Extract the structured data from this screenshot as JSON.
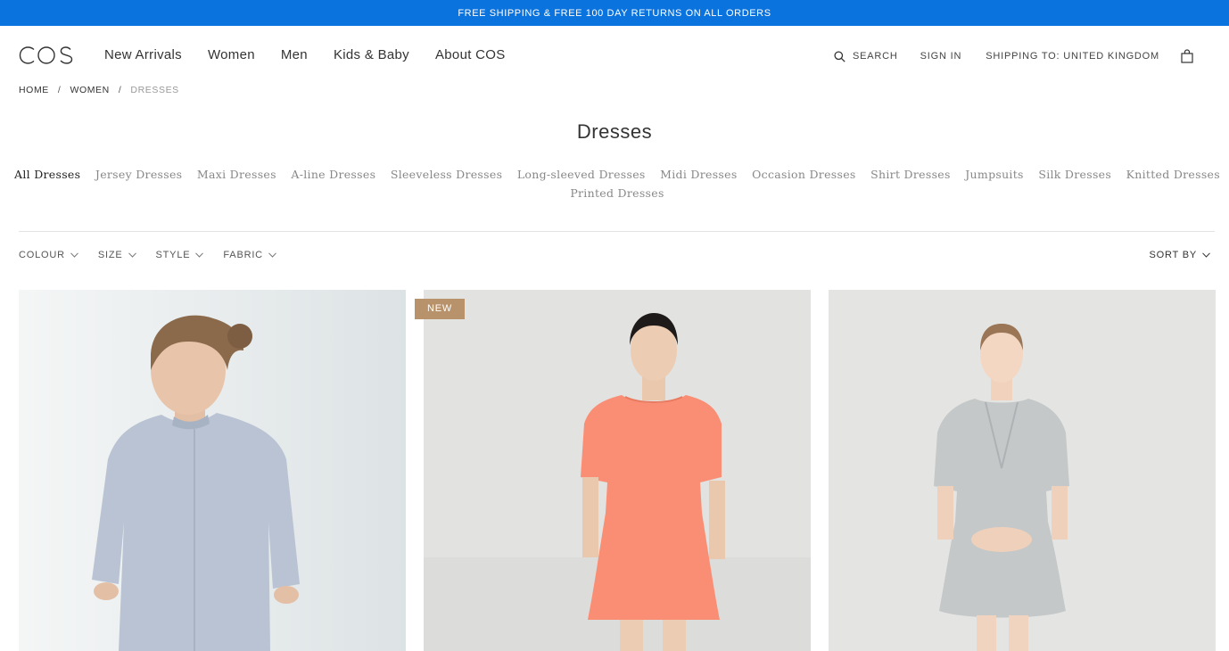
{
  "promo": {
    "text": "FREE SHIPPING & FREE 100 DAY RETURNS ON ALL ORDERS",
    "bg": "#0b73de"
  },
  "header": {
    "logo": "COS",
    "nav": [
      "New Arrivals",
      "Women",
      "Men",
      "Kids & Baby",
      "About COS"
    ],
    "search_label": "SEARCH",
    "search_icon": "search-icon",
    "sign_in": "SIGN IN",
    "shipping": "SHIPPING TO: UNITED KINGDOM",
    "bag_icon": "bag-icon"
  },
  "breadcrumb": [
    "HOME",
    "WOMEN",
    "DRESSES"
  ],
  "page_title": "Dresses",
  "categories": {
    "row1": [
      "All Dresses",
      "Jersey Dresses",
      "Maxi Dresses",
      "A-line Dresses",
      "Sleeveless Dresses",
      "Long-sleeved Dresses",
      "Midi Dresses",
      "Occasion Dresses",
      "Shirt Dresses",
      "Jumpsuits",
      "Silk Dresses",
      "Knitted Dresses"
    ],
    "row2": [
      "Printed Dresses"
    ],
    "active": "All Dresses"
  },
  "filters": [
    "COLOUR",
    "SIZE",
    "STYLE",
    "FABRIC"
  ],
  "sort_label": "SORT BY",
  "products": [
    {
      "badge": "",
      "dress_color": "#b9c3d3",
      "bg": "#e6ebec"
    },
    {
      "badge": "NEW",
      "dress_color": "#fb8f76",
      "bg": "#e2e2e2",
      "badge_color": "#b8926a"
    },
    {
      "badge": "",
      "dress_color": "#c3c7c8",
      "bg": "#e4e4e4"
    }
  ]
}
